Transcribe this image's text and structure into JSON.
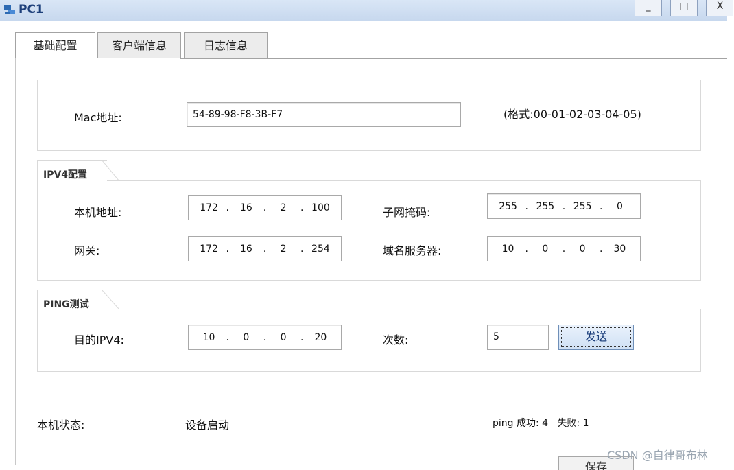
{
  "window": {
    "title": "PC1",
    "minimize": "_",
    "maximize": "□",
    "close": "X"
  },
  "tabs": [
    {
      "label": "基础配置",
      "active": true
    },
    {
      "label": "客户端信息",
      "active": false
    },
    {
      "label": "日志信息",
      "active": false
    }
  ],
  "mac": {
    "label": "Mac地址:",
    "value": "54-89-98-F8-3B-F7",
    "format_hint": "(格式:00-01-02-03-04-05)"
  },
  "ipv4": {
    "legend": "IPV4配置",
    "local_label": "本机地址:",
    "local_ip": [
      "172",
      "16",
      "2",
      "100"
    ],
    "mask_label": "子网掩码:",
    "mask": [
      "255",
      "255",
      "255",
      "0"
    ],
    "gateway_label": "网关:",
    "gateway": [
      "172",
      "16",
      "2",
      "254"
    ],
    "dns_label": "域名服务器:",
    "dns": [
      "10",
      "0",
      "0",
      "30"
    ]
  },
  "ping": {
    "legend": "PING测试",
    "dest_label": "目的IPV4:",
    "dest": [
      "10",
      "0",
      "0",
      "20"
    ],
    "count_label": "次数:",
    "count": "5",
    "send_label": "发送"
  },
  "status": {
    "label": "本机状态:",
    "value": "设备启动",
    "ping_result": "ping 成功: 4   失败: 1"
  },
  "bottom_button_label": "保存",
  "watermark": "CSDN @自律哥布林",
  "colors": {
    "titlebar": "#c7d8ee",
    "title_text": "#1d3f7a",
    "send_button": "#cfe0f4"
  }
}
